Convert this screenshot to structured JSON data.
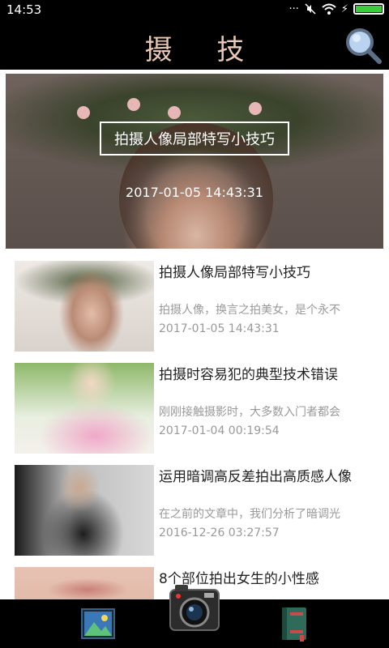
{
  "status_bar": {
    "time": "14:53",
    "icons": [
      "dots-icon",
      "mute-icon",
      "wifi-icon",
      "battery-icon"
    ],
    "more": "···",
    "charge": "⚡"
  },
  "header": {
    "title": "摄 技"
  },
  "hero": {
    "title": "拍摄人像局部特写小技巧",
    "date": "2017-01-05 14:43:31"
  },
  "articles": [
    {
      "title": "拍摄人像局部特写小技巧",
      "summary": "拍摄人像，换言之拍美女，是个永不",
      "date": "2017-01-05 14:43:31"
    },
    {
      "title": "拍摄时容易犯的典型技术错误",
      "summary": "刚刚接触摄影时，大多数入门者都会",
      "date": "2017-01-04 00:19:54"
    },
    {
      "title": "运用暗调高反差拍出高质感人像",
      "summary": "在之前的文章中，我们分析了暗调光",
      "date": "2016-12-26 03:27:57"
    },
    {
      "title": "8个部位拍出女生的小性感",
      "summary": "",
      "date": ""
    }
  ],
  "bottom_nav": {
    "items": [
      "gallery-icon",
      "camera-icon",
      "book-icon"
    ]
  },
  "colors": {
    "bar": "#000000",
    "title_text": "#e8c9b8",
    "battery": "#3ccd3c",
    "secondary_text": "#999999"
  }
}
